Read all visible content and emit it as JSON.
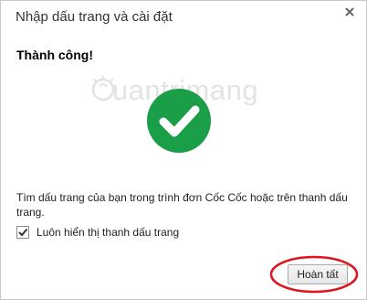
{
  "dialog": {
    "title": "Nhập dấu trang và cài đặt",
    "close_icon": "close-icon",
    "heading": "Thành công!",
    "watermark_text": "uantrimang",
    "success_icon": "checkmark-circle-icon",
    "success_color": "#1a9e47",
    "info_text": "Tìm dấu trang của bạn trong trình đơn Cốc Cốc hoặc trên thanh dấu trang.",
    "checkbox": {
      "label": "Luôn hiển thị thanh dấu trang",
      "checked": true
    },
    "done_button": "Hoàn tất",
    "highlight_color": "#e0141e"
  }
}
